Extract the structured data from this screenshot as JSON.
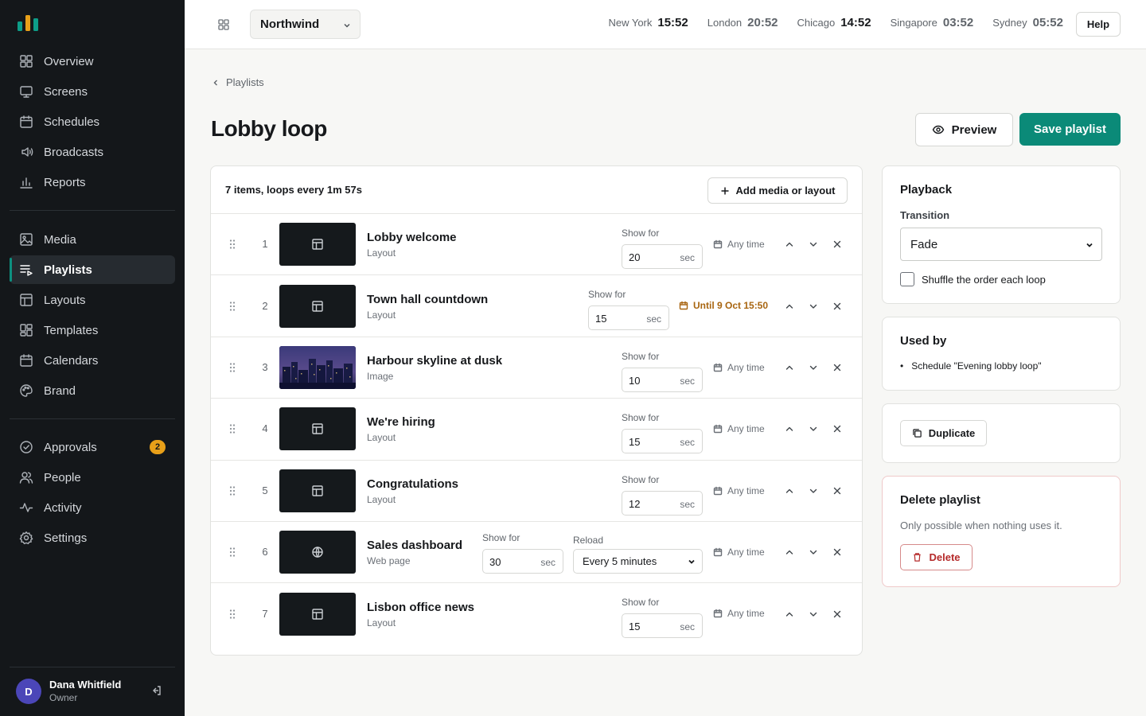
{
  "colors": {
    "accent": "#0b8a78",
    "sidebar_bg": "#14171a",
    "badge": "#e8a019",
    "danger": "#b52a2a",
    "warning": "#a86510"
  },
  "sidebar": {
    "groups": [
      [
        {
          "label": "Overview",
          "icon": "grid-icon"
        },
        {
          "label": "Screens",
          "icon": "monitor-icon"
        },
        {
          "label": "Schedules",
          "icon": "calendar-icon"
        },
        {
          "label": "Broadcasts",
          "icon": "broadcast-icon"
        },
        {
          "label": "Reports",
          "icon": "bar-chart-icon"
        }
      ],
      [
        {
          "label": "Media",
          "icon": "image-icon"
        },
        {
          "label": "Playlists",
          "icon": "playlist-icon",
          "active": true
        },
        {
          "label": "Layouts",
          "icon": "layout-icon"
        },
        {
          "label": "Templates",
          "icon": "templates-icon"
        },
        {
          "label": "Calendars",
          "icon": "calendar-icon"
        },
        {
          "label": "Brand",
          "icon": "palette-icon"
        }
      ],
      [
        {
          "label": "Approvals",
          "icon": "check-circle-icon",
          "badge": "2"
        },
        {
          "label": "People",
          "icon": "people-icon"
        },
        {
          "label": "Activity",
          "icon": "activity-icon"
        },
        {
          "label": "Settings",
          "icon": "gear-icon"
        }
      ]
    ],
    "user": {
      "initial": "D",
      "name": "Dana Whitfield",
      "role": "Owner"
    }
  },
  "topbar": {
    "org": "Northwind",
    "clocks": [
      {
        "city": "New York",
        "time": "15:52",
        "dim": false
      },
      {
        "city": "London",
        "time": "20:52",
        "dim": true
      },
      {
        "city": "Chicago",
        "time": "14:52",
        "dim": false
      },
      {
        "city": "Singapore",
        "time": "03:52",
        "dim": true
      },
      {
        "city": "Sydney",
        "time": "05:52",
        "dim": true
      }
    ],
    "help": "Help"
  },
  "page": {
    "breadcrumb": "Playlists",
    "title": "Lobby loop",
    "preview": "Preview",
    "save": "Save playlist"
  },
  "playlist": {
    "summary": "7 items, loops every 1m 57s",
    "add_button": "Add media or layout",
    "show_for_label": "Show for",
    "unit": "sec",
    "reload_label": "Reload",
    "items": [
      {
        "num": "1",
        "name": "Lobby welcome",
        "type": "Layout",
        "duration": "20",
        "schedule": "Any time",
        "thumb": "layout"
      },
      {
        "num": "2",
        "name": "Town hall countdown",
        "type": "Layout",
        "duration": "15",
        "schedule": "Until 9 Oct 15:50",
        "warn": true,
        "thumb": "layout"
      },
      {
        "num": "3",
        "name": "Harbour skyline at dusk",
        "type": "Image",
        "duration": "10",
        "schedule": "Any time",
        "thumb": "image"
      },
      {
        "num": "4",
        "name": "We're hiring",
        "type": "Layout",
        "duration": "15",
        "schedule": "Any time",
        "thumb": "layout"
      },
      {
        "num": "5",
        "name": "Congratulations",
        "type": "Layout",
        "duration": "12",
        "schedule": "Any time",
        "thumb": "layout"
      },
      {
        "num": "6",
        "name": "Sales dashboard",
        "type": "Web page",
        "duration": "30",
        "schedule": "Any time",
        "thumb": "web",
        "reload": "Every 5 minutes"
      },
      {
        "num": "7",
        "name": "Lisbon office news",
        "type": "Layout",
        "duration": "15",
        "schedule": "Any time",
        "thumb": "layout"
      }
    ]
  },
  "playback": {
    "title": "Playback",
    "transition_label": "Transition",
    "transition": "Fade",
    "shuffle_label": "Shuffle the order each loop"
  },
  "used_by": {
    "title": "Used by",
    "items": [
      "Schedule \"Evening lobby loop\""
    ]
  },
  "duplicate": "Duplicate",
  "delete_card": {
    "title": "Delete playlist",
    "help": "Only possible when nothing uses it.",
    "button": "Delete"
  }
}
